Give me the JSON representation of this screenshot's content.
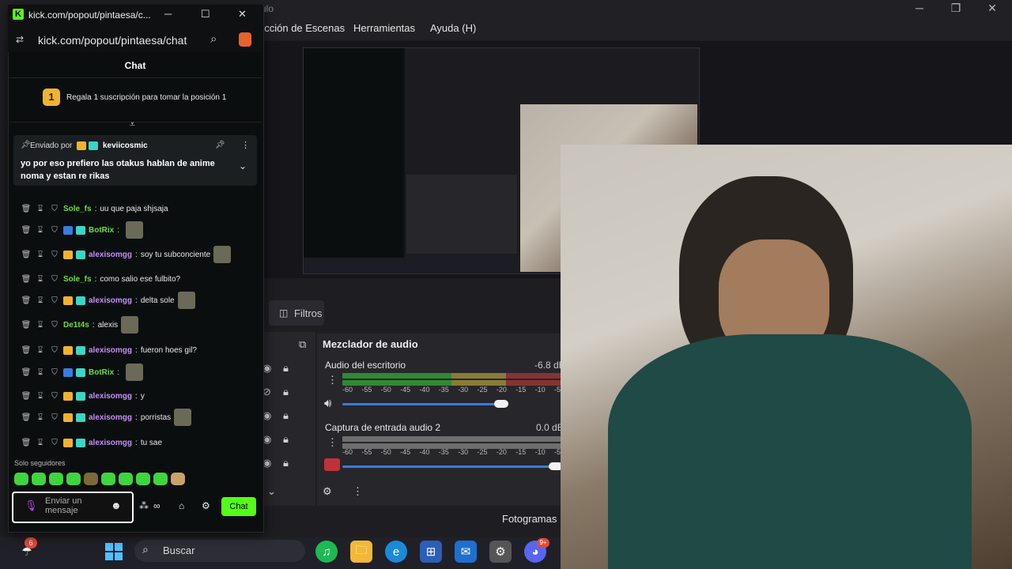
{
  "obs": {
    "title": "ulo",
    "menu": [
      "ección de Escenas",
      "Herramientas",
      "Ayuda (H)"
    ],
    "filters_tab": "Filtros",
    "mixer": {
      "title": "Mezclador de audio",
      "channels": [
        {
          "name": "Audio del escritorio",
          "db": "-6.8 dB",
          "level": 0.9
        },
        {
          "name": "Captura de entrada audio 2",
          "db": "0.0 dB",
          "level": 0.5
        }
      ],
      "scale": [
        "-60",
        "-55",
        "-50",
        "-45",
        "-40",
        "-35",
        "-30",
        "-25",
        "-20",
        "-15",
        "-10",
        "-5"
      ]
    },
    "status": "Fotogramas"
  },
  "kick": {
    "window_title": "kick.com/popout/pintaesa/c...",
    "url": "kick.com/popout/pintaesa/chat",
    "chat_title": "Chat",
    "sub_rank": "1",
    "sub_text": "Regala 1 suscripción para tomar la posición 1",
    "pinned": {
      "sender_label": "Enviado por",
      "user": "keviicosmic",
      "message": "yo por eso prefiero las otakus hablan de anime noma y estan re rikas"
    },
    "messages": [
      {
        "user": "Sole_fs",
        "color": "#6fdc3c",
        "text": "uu que paja shjsaja",
        "emote": false
      },
      {
        "user": "BotRix",
        "color": "#6fdc3c",
        "text": "",
        "emote": true
      },
      {
        "user": "alexisomgg",
        "color": "#c58df5",
        "text": "soy tu subconciente",
        "emote": true
      },
      {
        "user": "Sole_fs",
        "color": "#6fdc3c",
        "text": "como salio ese fulbito?",
        "emote": false
      },
      {
        "user": "alexisomgg",
        "color": "#c58df5",
        "text": "delta  sole",
        "emote": true
      },
      {
        "user": "De1t4s",
        "color": "#6fdc3c",
        "text": "alexis",
        "emote": true
      },
      {
        "user": "alexisomgg",
        "color": "#c58df5",
        "text": "fueron hoes gil?",
        "emote": false
      },
      {
        "user": "BotRix",
        "color": "#6fdc3c",
        "text": "",
        "emote": true
      },
      {
        "user": "alexisomgg",
        "color": "#c58df5",
        "text": "y",
        "emote": false
      },
      {
        "user": "alexisomgg",
        "color": "#c58df5",
        "text": "porristas",
        "emote": true
      },
      {
        "user": "alexisomgg",
        "color": "#c58df5",
        "text": "tu sae",
        "emote": false
      }
    ],
    "followers_only": "Solo seguidores",
    "input_placeholder": "Enviar un mensaje",
    "send_button": "Chat"
  },
  "taskbar": {
    "search_label": "Buscar",
    "weather_badge": "6",
    "discord_badge": "9+"
  }
}
